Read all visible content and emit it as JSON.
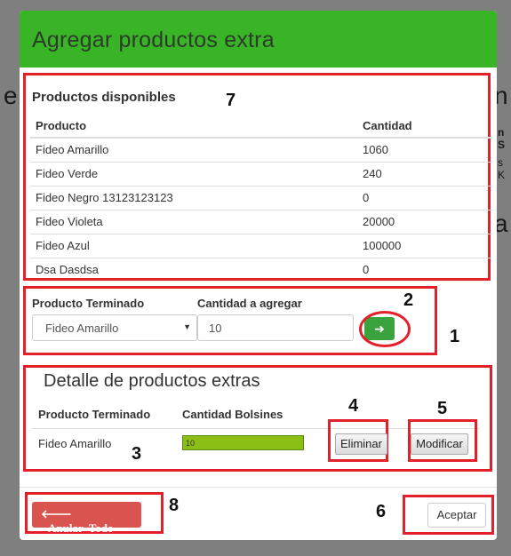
{
  "background": {
    "left_fragment": "e",
    "right_fragment": "n",
    "right_fragment_2": "a",
    "right_small_1": "n S",
    "right_small_2": "s K"
  },
  "modal": {
    "title": "Agregar productos extra",
    "header_color": "#3ab427"
  },
  "productos_disponibles": {
    "title": "Productos disponibles",
    "annotation": "7",
    "columns": [
      "Producto",
      "Cantidad"
    ],
    "rows": [
      {
        "producto": "Fideo Amarillo",
        "cantidad": "1060"
      },
      {
        "producto": "Fideo Verde",
        "cantidad": "240"
      },
      {
        "producto": "Fideo Negro 13123123123",
        "cantidad": "0"
      },
      {
        "producto": "Fideo Violeta",
        "cantidad": "20000"
      },
      {
        "producto": "Fideo Azul",
        "cantidad": "100000"
      },
      {
        "producto": "Dsa Dasdsa",
        "cantidad": "0"
      }
    ]
  },
  "form": {
    "annotation_section": "1",
    "annotation_button": "2",
    "producto_label": "Producto Terminado",
    "producto_value": "Fideo Amarillo",
    "cantidad_label": "Cantidad a agregar",
    "cantidad_value": "10",
    "add_icon": "arrow-right-icon"
  },
  "detalle": {
    "title": "Detalle de productos extras",
    "annotation": "3",
    "annotation_eliminar": "4",
    "annotation_modificar": "5",
    "col_producto": "Producto Terminado",
    "col_cantidad": "Cantidad Bolsines",
    "row_producto": "Fideo Amarillo",
    "row_cantidad": "10",
    "eliminar_label": "Eliminar",
    "modificar_label": "Modificar"
  },
  "footer": {
    "anular_label": "Anular  Todo",
    "anular_icon": "arrow-left-icon",
    "annotation_anular": "8",
    "aceptar_label": "Aceptar",
    "annotation_aceptar": "6"
  },
  "colors": {
    "annotation_red": "#e3202a",
    "danger": "#d9534f",
    "success": "#3aa33d",
    "bar_fill": "#8cbf15"
  }
}
